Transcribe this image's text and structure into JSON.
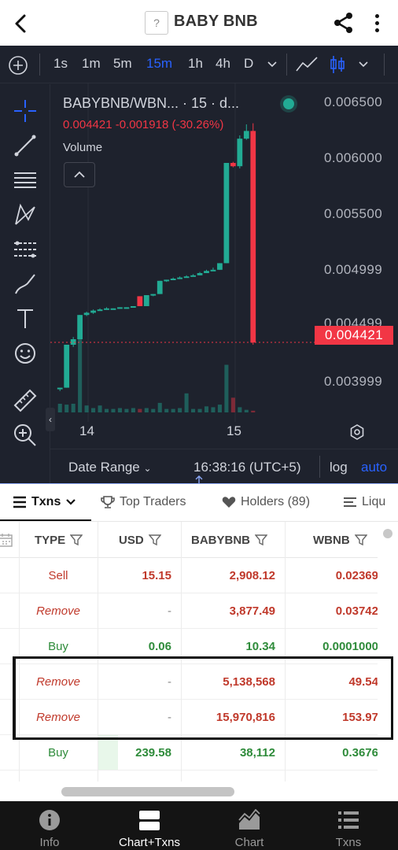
{
  "appbar": {
    "title": "BABY BNB",
    "token_logo_glyph": "?"
  },
  "toolbar": {
    "timeframes": [
      "1s",
      "1m",
      "5m",
      "15m",
      "1h",
      "4h",
      "D"
    ],
    "active_timeframe": "15m"
  },
  "chart": {
    "symbol_legend": "BABYBNB/WBN... · 15 · d...",
    "price_change": "0.004421 -0.001918 (-30.26%)",
    "volume_label": "Volume",
    "price_axis": [
      "0.006500",
      "0.006000",
      "0.005500",
      "0.004999",
      "0.004499",
      "0.003999"
    ],
    "current_price": "0.004421",
    "time_axis": [
      "14",
      "15"
    ],
    "date_range_label": "Date Range",
    "clock": "16:38:16 (UTC+5)",
    "log_label": "log",
    "auto_label": "auto",
    "colors": {
      "up": "#22ab94",
      "down": "#f23645",
      "background": "#1e222d",
      "accent": "#2962ff"
    }
  },
  "chart_data": {
    "type": "candlestick",
    "ylim": [
      0.0037,
      0.0066
    ],
    "candles": [
      {
        "o": 0.004,
        "h": 0.00401,
        "l": 0.00398,
        "c": 0.00401
      },
      {
        "o": 0.00401,
        "h": 0.0044,
        "l": 0.00401,
        "c": 0.0044
      },
      {
        "o": 0.0044,
        "h": 0.00447,
        "l": 0.00438,
        "c": 0.00445
      },
      {
        "o": 0.00445,
        "h": 0.00467,
        "l": 0.00445,
        "c": 0.00467
      },
      {
        "o": 0.00467,
        "h": 0.0047,
        "l": 0.00466,
        "c": 0.00469
      },
      {
        "o": 0.00469,
        "h": 0.00472,
        "l": 0.00468,
        "c": 0.00471
      },
      {
        "o": 0.00471,
        "h": 0.00473,
        "l": 0.00471,
        "c": 0.00472
      },
      {
        "o": 0.00472,
        "h": 0.00474,
        "l": 0.00472,
        "c": 0.00473
      },
      {
        "o": 0.00473,
        "h": 0.00473,
        "l": 0.00472,
        "c": 0.00473
      },
      {
        "o": 0.00473,
        "h": 0.00474,
        "l": 0.00473,
        "c": 0.00474
      },
      {
        "o": 0.00474,
        "h": 0.00474,
        "l": 0.00473,
        "c": 0.00474
      },
      {
        "o": 0.00474,
        "h": 0.00475,
        "l": 0.00474,
        "c": 0.00475
      },
      {
        "o": 0.00484,
        "h": 0.00484,
        "l": 0.00475,
        "c": 0.00475
      },
      {
        "o": 0.00475,
        "h": 0.00485,
        "l": 0.00475,
        "c": 0.00485
      },
      {
        "o": 0.00485,
        "h": 0.00486,
        "l": 0.00484,
        "c": 0.00486
      },
      {
        "o": 0.00486,
        "h": 0.00498,
        "l": 0.00486,
        "c": 0.00498
      },
      {
        "o": 0.00498,
        "h": 0.00499,
        "l": 0.00497,
        "c": 0.00499
      },
      {
        "o": 0.00499,
        "h": 0.00501,
        "l": 0.00499,
        "c": 0.005
      },
      {
        "o": 0.005,
        "h": 0.00502,
        "l": 0.005,
        "c": 0.00501
      },
      {
        "o": 0.00501,
        "h": 0.00503,
        "l": 0.00501,
        "c": 0.00502
      },
      {
        "o": 0.00502,
        "h": 0.00504,
        "l": 0.00502,
        "c": 0.00503
      },
      {
        "o": 0.00503,
        "h": 0.00506,
        "l": 0.00503,
        "c": 0.00505
      },
      {
        "o": 0.00505,
        "h": 0.00508,
        "l": 0.00505,
        "c": 0.00507
      },
      {
        "o": 0.00507,
        "h": 0.0051,
        "l": 0.00507,
        "c": 0.00508
      },
      {
        "o": 0.00508,
        "h": 0.00514,
        "l": 0.00508,
        "c": 0.00514
      },
      {
        "o": 0.00514,
        "h": 0.00605,
        "l": 0.00514,
        "c": 0.00605
      },
      {
        "o": 0.00605,
        "h": 0.00606,
        "l": 0.00601,
        "c": 0.00602
      },
      {
        "o": 0.00602,
        "h": 0.0063,
        "l": 0.006,
        "c": 0.00627
      },
      {
        "o": 0.00627,
        "h": 0.0064,
        "l": 0.00626,
        "c": 0.00634
      },
      {
        "o": 0.00634,
        "h": 0.00641,
        "l": 0.0044,
        "c": 0.00442
      }
    ],
    "volumes": [
      0.1,
      0.09,
      0.1,
      0.85,
      0.08,
      0.05,
      0.08,
      0.04,
      0.04,
      0.05,
      0.04,
      0.05,
      0.04,
      0.05,
      0.04,
      0.11,
      0.04,
      0.04,
      0.05,
      0.22,
      0.04,
      0.04,
      0.07,
      0.06,
      0.09,
      0.55,
      0.17,
      0.06,
      0.03,
      0.02
    ]
  },
  "tabs": [
    {
      "label": "Txns",
      "icon": "list-icon"
    },
    {
      "label": "Top Traders",
      "icon": "trophy-icon"
    },
    {
      "label": "Holders (89)",
      "icon": "heart-icon"
    },
    {
      "label": "Liqu",
      "icon": "bars-icon"
    }
  ],
  "table": {
    "headers": [
      "TYPE",
      "USD",
      "BABYBNB",
      "WBNB"
    ],
    "rows": [
      {
        "type": "Sell",
        "usd": "15.15",
        "babybnb": "2,908.12",
        "wbnb": "0.02369",
        "kind": "sell"
      },
      {
        "type": "Remove",
        "usd": "-",
        "babybnb": "3,877.49",
        "wbnb": "0.03742",
        "kind": "remove"
      },
      {
        "type": "Buy",
        "usd": "0.06",
        "babybnb": "10.34",
        "wbnb": "0.0001000",
        "kind": "buy"
      },
      {
        "type": "Remove",
        "usd": "-",
        "babybnb": "5,138,568",
        "wbnb": "49.54",
        "kind": "remove"
      },
      {
        "type": "Remove",
        "usd": "-",
        "babybnb": "15,970,816",
        "wbnb": "153.97",
        "kind": "remove"
      },
      {
        "type": "Buy",
        "usd": "239.58",
        "babybnb": "38,112",
        "wbnb": "0.3676",
        "kind": "buy"
      }
    ]
  },
  "bottom_nav": [
    {
      "label": "Info",
      "icon": "info-icon",
      "active": false
    },
    {
      "label": "Chart+Txns",
      "icon": "split-icon",
      "active": true
    },
    {
      "label": "Chart",
      "icon": "chart-icon",
      "active": false
    },
    {
      "label": "Txns",
      "icon": "list-icon",
      "active": false
    }
  ]
}
